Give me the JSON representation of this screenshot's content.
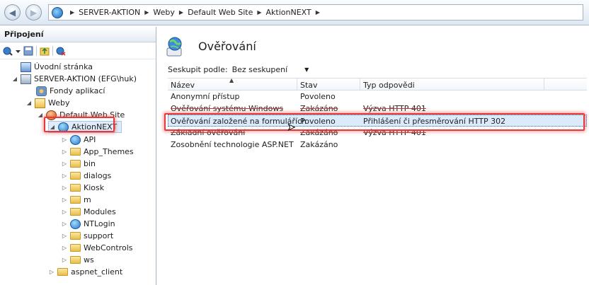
{
  "address": {
    "crumbs": [
      "SERVER-AKTION",
      "Weby",
      "Default Web Site",
      "AktionNEXT"
    ]
  },
  "left_pane": {
    "header": "Připojení",
    "tree": [
      {
        "label": "Úvodní stránka",
        "icon": "home-icon"
      },
      {
        "label": "SERVER-AKTION (EFG\\huk)",
        "icon": "server-icon"
      },
      {
        "label": "Fondy aplikací",
        "icon": "app-pool-icon"
      },
      {
        "label": "Weby",
        "icon": "sites-icon"
      },
      {
        "label": "Default Web Site",
        "icon": "website-icon"
      },
      {
        "label": "AktionNEXT",
        "icon": "application-icon"
      },
      {
        "label": "API",
        "icon": "application-icon"
      },
      {
        "label": "App_Themes",
        "icon": "folder-icon"
      },
      {
        "label": "bin",
        "icon": "folder-icon"
      },
      {
        "label": "dialogs",
        "icon": "folder-icon"
      },
      {
        "label": "Kiosk",
        "icon": "folder-icon"
      },
      {
        "label": "m",
        "icon": "folder-icon"
      },
      {
        "label": "Modules",
        "icon": "folder-icon"
      },
      {
        "label": "NTLogin",
        "icon": "application-icon"
      },
      {
        "label": "support",
        "icon": "folder-icon"
      },
      {
        "label": "WebControls",
        "icon": "folder-icon"
      },
      {
        "label": "ws",
        "icon": "folder-icon"
      },
      {
        "label": "aspnet_client",
        "icon": "folder-icon"
      }
    ]
  },
  "main": {
    "title": "Ověřování",
    "group_by_label": "Seskupit podle:",
    "group_by_value": "Bez seskupení",
    "columns": [
      "Název",
      "Stav",
      "Typ odpovědi"
    ],
    "rows": [
      {
        "name": "Anonymní přístup",
        "status": "Povoleno",
        "response": ""
      },
      {
        "name": "Ověřování systému Windows",
        "status": "Zakázáno",
        "response": "Výzva HTTP 401"
      },
      {
        "name": "Ověřování založené na formulářích",
        "status": "Povoleno",
        "response": "Přihlášení či přesměrování HTTP 302"
      },
      {
        "name": "Základní ověřování",
        "status": "Zakázáno",
        "response": "Výzva HTTP 401"
      },
      {
        "name": "Zosobnění technologie ASP.NET",
        "status": "Zakázáno",
        "response": ""
      }
    ]
  },
  "colors": {
    "highlight_red": "#e33b3b",
    "selection_blue": "#dcebfb"
  }
}
